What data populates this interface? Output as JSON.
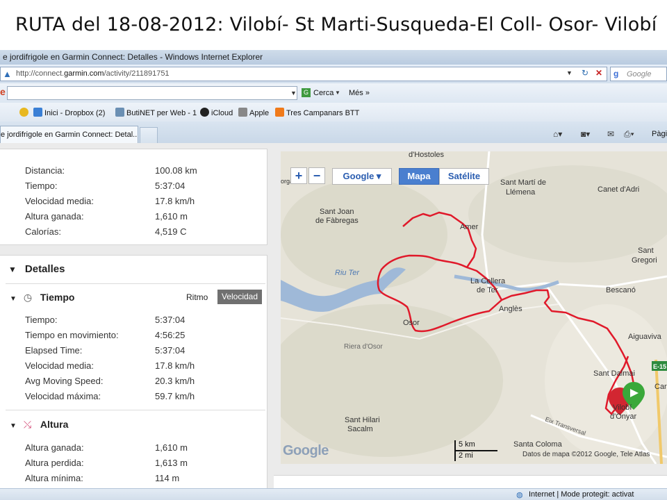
{
  "slide": {
    "title": "RUTA del 18-08-2012:  Vilobí- St Marti-Susqueda-El Coll- Osor- Vilobí"
  },
  "browser": {
    "window_title": "e jordifrigole en Garmin Connect: Detalles - Windows Internet Explorer",
    "address": {
      "prefix": "http://connect.",
      "domain": "garmin.com",
      "suffix": "/activity/211891751"
    },
    "search_placeholder": "Google",
    "toolbar": {
      "search_label": "Cerca",
      "more_label": "Més »"
    },
    "favorites": [
      {
        "label": "Inici - Dropbox (2)",
        "icon": "dropbox-icon",
        "color": "#3a7fd5"
      },
      {
        "label": "ButiNET per Web - 1",
        "icon": "butinet-icon",
        "color": "#6a8fb3"
      },
      {
        "label": "iCloud",
        "icon": "apple-icon",
        "color": "#222222"
      },
      {
        "label": "Apple",
        "icon": "apple-page-icon",
        "color": "#888888"
      },
      {
        "label": "Tres Campanars BTT",
        "icon": "blogger-icon",
        "color": "#f07a1a"
      }
    ],
    "tab_title": "e jordifrigole en Garmin Connect: Detal...",
    "page_label": "Pàgi",
    "status": "Internet | Mode protegit: activat"
  },
  "summary": [
    {
      "label": "Distancia:",
      "value": "100.08 km"
    },
    {
      "label": "Tiempo:",
      "value": "5:37:04"
    },
    {
      "label": "Velocidad media:",
      "value": "17.8 km/h"
    },
    {
      "label": "Altura ganada:",
      "value": "1,610 m"
    },
    {
      "label": "Calorías:",
      "value": "4,519 C"
    }
  ],
  "details": {
    "heading": "Detalles",
    "tiempo": {
      "heading": "Tiempo",
      "toggle_ritmo": "Ritmo",
      "toggle_velocidad": "Velocidad",
      "rows": [
        {
          "label": "Tiempo:",
          "value": "5:37:04"
        },
        {
          "label": "Tiempo en movimiento:",
          "value": "4:56:25"
        },
        {
          "label": "Elapsed Time:",
          "value": "5:37:04"
        },
        {
          "label": "Velocidad media:",
          "value": "17.8 km/h"
        },
        {
          "label": "Avg Moving Speed:",
          "value": "20.3 km/h"
        },
        {
          "label": "Velocidad máxima:",
          "value": "59.7 km/h"
        }
      ]
    },
    "altura": {
      "heading": "Altura",
      "rows": [
        {
          "label": "Altura ganada:",
          "value": "1,610 m"
        },
        {
          "label": "Altura perdida:",
          "value": "1,613 m"
        },
        {
          "label": "Altura mínima:",
          "value": "114 m"
        }
      ]
    }
  },
  "map": {
    "zoom_in": "+",
    "zoom_out": "−",
    "type_dropdown": "Google ▾",
    "type_map": "Mapa",
    "type_satellite": "Satélite",
    "logo": "Google",
    "scale_km": "5 km",
    "scale_mi": "2 mi",
    "copyright": "Datos de mapa ©2012 Google, Tele Atlas",
    "places": [
      "d'Hostoles",
      "orgàs",
      "Sant Martí de",
      "Llémena",
      "Canet d'Adri",
      "Sant Joan",
      "de Fàbregas",
      "Amer",
      "Sant",
      "Gregori",
      "Riu Ter",
      "La Cellera",
      "de Ter",
      "Bescanó",
      "Anglès",
      "Osor",
      "Riera d'Osor",
      "Aiguaviva",
      "E-15",
      "Sant Dalmai",
      "Car",
      "Vilobí",
      "d'Onyar",
      "Eix Transversal",
      "Sant Hilari",
      "Sacalm",
      "Santa Coloma"
    ],
    "route_color": "#e0192a",
    "water_color": "#9fb9d8"
  }
}
